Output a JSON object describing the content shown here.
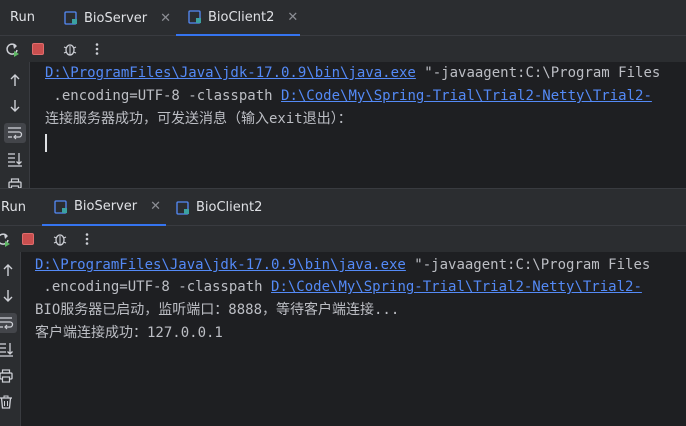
{
  "top_panel": {
    "title": "Run",
    "tabs": [
      {
        "label": "BioServer",
        "active": false
      },
      {
        "label": "BioClient2",
        "active": true
      }
    ],
    "console": {
      "java_path": "D:\\ProgramFiles\\Java\\jdk-17.0.9\\bin\\java.exe",
      "java_args": " \"-javaagent:C:\\Program Files",
      "encoding_prefix": " .encoding=UTF-8 -classpath ",
      "classpath": "D:\\Code\\My\\Spring-Trial\\Trial2-Netty\\Trial2-",
      "message": "连接服务器成功，可发送消息（输入exit退出）："
    }
  },
  "bottom_panel": {
    "title": "Run",
    "tabs": [
      {
        "label": "BioServer",
        "active": true
      },
      {
        "label": "BioClient2",
        "active": false
      }
    ],
    "console": {
      "java_path": "D:\\ProgramFiles\\Java\\jdk-17.0.9\\bin\\java.exe",
      "java_args": " \"-javaagent:C:\\Program Files",
      "encoding_prefix": " .encoding=UTF-8 -classpath ",
      "classpath": "D:\\Code\\My\\Spring-Trial\\Trial2-Netty\\Trial2-",
      "message1": "BIO服务器已启动，监听端口：8888，等待客户端连接...",
      "message2": "客户端连接成功：127.0.0.1"
    }
  },
  "colors": {
    "background": "#1e1f22",
    "toolbar": "#2b2d30",
    "link": "#548af7",
    "text": "#bcbec4",
    "accent": "#3574f0",
    "stop": "#c94f4f",
    "run": "#5fb865"
  },
  "icons": [
    "rerun-icon",
    "stop-icon",
    "bug-icon",
    "more-icon",
    "arrow-up-icon",
    "arrow-down-icon",
    "soft-wrap-icon",
    "scroll-to-end-icon",
    "print-icon",
    "trash-icon",
    "java-class-icon"
  ]
}
